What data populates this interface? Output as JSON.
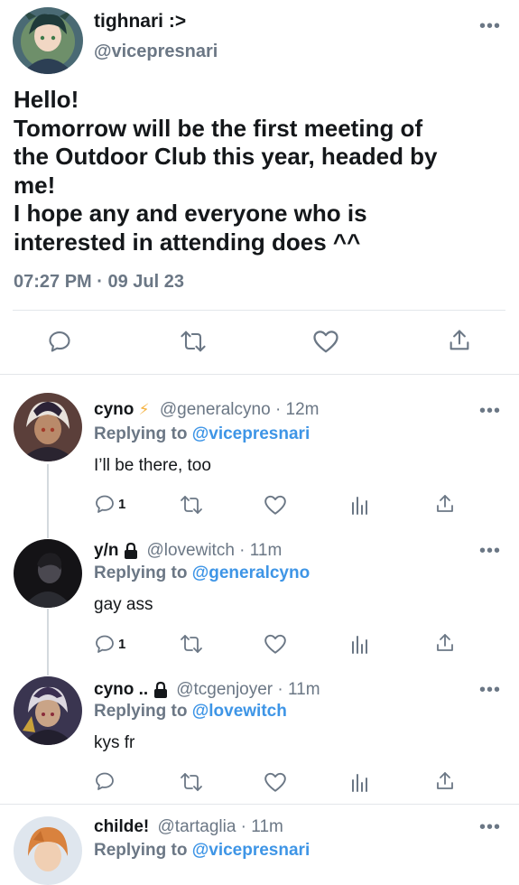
{
  "main_tweet": {
    "display_name": "tighnari :>",
    "handle": "@vicepresnari",
    "text_lines": [
      "Hello!",
      "Tomorrow will be the first meeting of",
      "the Outdoor Club this year, headed by",
      "me!",
      "I hope any and everyone who is",
      "interested in attending does ^^"
    ],
    "timestamp": "07:27 PM · 09 Jul 23"
  },
  "replies": [
    {
      "display_name": "cyno",
      "badge": "⚡",
      "handle_time": "@generalcyno · 12m",
      "replying_prefix": "Replying to",
      "replying_to": "@vicepresnari",
      "text": "I’ll be there, too",
      "reply_count": "1"
    },
    {
      "display_name": "y/n",
      "badge": "lock-icon",
      "handle_time": "@lovewitch · 11m",
      "replying_prefix": "Replying to",
      "replying_to": "@generalcyno",
      "text": "gay ass",
      "reply_count": "1"
    },
    {
      "display_name": "cyno ..",
      "badge": "lock-icon",
      "handle_time": "@tcgenjoyer · 11m",
      "replying_prefix": "Replying to",
      "replying_to": "@lovewitch",
      "text": "kys fr",
      "reply_count": ""
    },
    {
      "display_name": "childe!",
      "badge": "",
      "handle_time": "@tartaglia · 11m",
      "replying_prefix": "Replying to",
      "replying_to": "@vicepresnari"
    }
  ],
  "colors": {
    "accent": "#3e95e6",
    "grey": "#6b7785",
    "bolt": "#f5b342"
  }
}
